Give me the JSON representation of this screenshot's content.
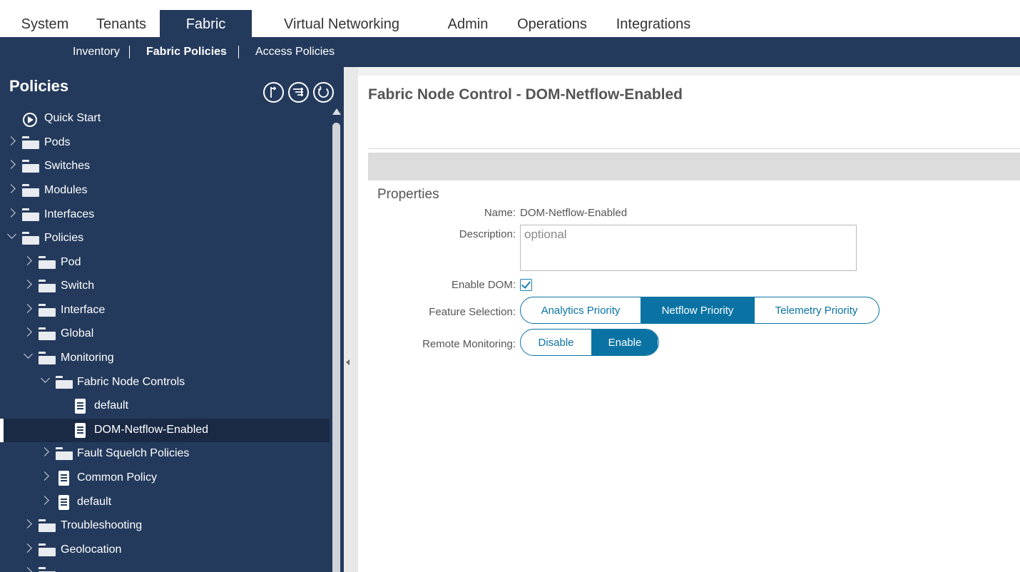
{
  "top_tabs": [
    "System",
    "Tenants",
    "Fabric",
    "Virtual Networking",
    "Admin",
    "Operations",
    "Integrations"
  ],
  "active_top_tab": "Fabric",
  "sub_nav": [
    "Inventory",
    "Fabric Policies",
    "Access Policies"
  ],
  "active_sub_nav": "Fabric Policies",
  "left_panel": {
    "title": "Policies",
    "tree": [
      {
        "label": "Quick Start",
        "icon": "quick-start-icon",
        "state": "none"
      },
      {
        "label": "Pods",
        "icon": "folder-icon",
        "state": "collapsed"
      },
      {
        "label": "Switches",
        "icon": "folder-icon",
        "state": "collapsed"
      },
      {
        "label": "Modules",
        "icon": "folder-icon",
        "state": "collapsed"
      },
      {
        "label": "Interfaces",
        "icon": "folder-icon",
        "state": "collapsed"
      },
      {
        "label": "Policies",
        "icon": "folder-icon",
        "state": "expanded"
      },
      {
        "label": "Pod",
        "icon": "folder-icon",
        "state": "collapsed"
      },
      {
        "label": "Switch",
        "icon": "folder-icon",
        "state": "collapsed"
      },
      {
        "label": "Interface",
        "icon": "folder-icon",
        "state": "collapsed"
      },
      {
        "label": "Global",
        "icon": "folder-icon",
        "state": "collapsed"
      },
      {
        "label": "Monitoring",
        "icon": "folder-icon",
        "state": "expanded"
      },
      {
        "label": "Fabric Node Controls",
        "icon": "folder-icon",
        "state": "expanded"
      },
      {
        "label": "default",
        "icon": "document-icon",
        "state": "none"
      },
      {
        "label": "DOM-Netflow-Enabled",
        "icon": "document-icon",
        "state": "none",
        "selected": true
      },
      {
        "label": "Fault Squelch Policies",
        "icon": "folder-icon",
        "state": "collapsed"
      },
      {
        "label": "Common Policy",
        "icon": "document-icon",
        "state": "collapsed"
      },
      {
        "label": "default",
        "icon": "document-icon",
        "state": "collapsed"
      },
      {
        "label": "Troubleshooting",
        "icon": "folder-icon",
        "state": "collapsed"
      },
      {
        "label": "Geolocation",
        "icon": "folder-icon",
        "state": "collapsed"
      },
      {
        "label": "",
        "icon": "folder-icon",
        "state": "collapsed"
      }
    ]
  },
  "main": {
    "title": "Fabric Node Control - DOM-Netflow-Enabled",
    "section": "Properties",
    "name_label": "Name:",
    "name_value": "DOM-Netflow-Enabled",
    "description_label": "Description:",
    "description_placeholder": "optional",
    "enable_dom_label": "Enable DOM:",
    "enable_dom_checked": true,
    "feature_selection_label": "Feature Selection:",
    "feature_options": [
      "Analytics Priority",
      "Netflow Priority",
      "Telemetry Priority"
    ],
    "feature_selected": "Netflow Priority",
    "remote_monitoring_label": "Remote Monitoring:",
    "remote_options": [
      "Disable",
      "Enable"
    ],
    "remote_selected": "Enable"
  },
  "colors": {
    "nav_bg": "#243a5c",
    "accent": "#0a73a4"
  }
}
